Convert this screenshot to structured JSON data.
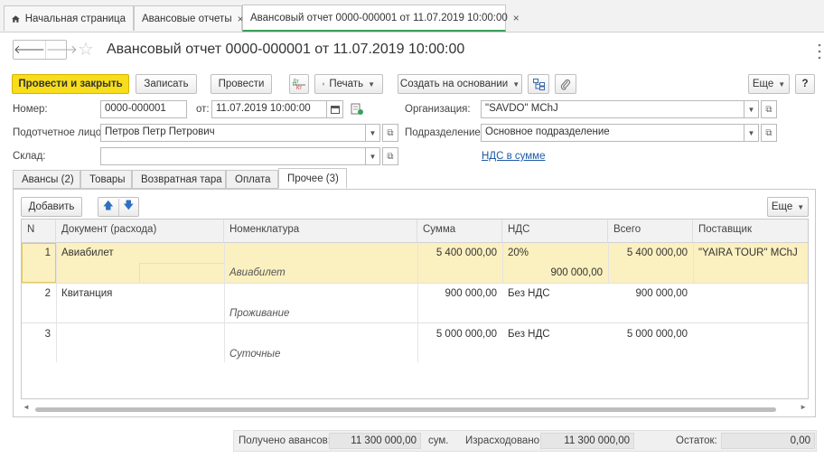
{
  "tabs": {
    "home": "Начальная страница",
    "list": "Авансовые отчеты",
    "doc": "Авансовый отчет 0000-000001 от 11.07.2019 10:00:00"
  },
  "title": "Авансовый отчет 0000-000001 от 11.07.2019 10:00:00",
  "toolbar": {
    "post_close": "Провести и закрыть",
    "save": "Записать",
    "post": "Провести",
    "dtkt": "Дт Кт",
    "print": "Печать",
    "create_based": "Создать на основании",
    "more": "Еще"
  },
  "fields": {
    "number_label": "Номер:",
    "number_value": "0000-000001",
    "date_label": "от:",
    "date_value": "11.07.2019 10:00:00",
    "org_label": "Организация:",
    "org_value": "\"SAVDO\" MChJ",
    "person_label": "Подотчетное лицо:",
    "person_value": "Петров Петр Петрович",
    "dept_label": "Подразделение:",
    "dept_value": "Основное подразделение",
    "warehouse_label": "Склад:",
    "warehouse_value": "",
    "vat_link": "НДС в сумме"
  },
  "inner_tabs": [
    "Авансы (2)",
    "Товары",
    "Возвратная тара",
    "Оплата",
    "Прочее (3)"
  ],
  "table_toolbar": {
    "add": "Добавить",
    "more": "Еще"
  },
  "columns": [
    "N",
    "Документ (расхода)",
    "Номенклатура",
    "Сумма",
    "НДС",
    "Всего",
    "Поставщик"
  ],
  "rows": [
    {
      "n": "1",
      "doc": "Авиабилет",
      "nomen": "Авиабилет",
      "sum": "5 400 000,00",
      "vat": "20%",
      "vat_sum": "900 000,00",
      "total": "5 400 000,00",
      "supplier": "\"YAIRA TOUR\" MChJ"
    },
    {
      "n": "2",
      "doc": "Квитанция",
      "nomen": "Проживание",
      "sum": "900 000,00",
      "vat": "Без НДС",
      "vat_sum": "",
      "total": "900 000,00",
      "supplier": ""
    },
    {
      "n": "3",
      "doc": "",
      "nomen": "Суточные",
      "sum": "5 000 000,00",
      "vat": "Без НДС",
      "vat_sum": "",
      "total": "5 000 000,00",
      "supplier": ""
    }
  ],
  "footer": {
    "received_label": "Получено авансов:",
    "received_value": "11 300 000,00",
    "currency": "сум.",
    "spent_label": "Израсходовано:",
    "spent_value": "11 300 000,00",
    "balance_label": "Остаток:",
    "balance_value": "0,00"
  },
  "colors": {
    "primary_button": "#f7dd1b",
    "row_highlight": "#fbf0bf",
    "active_tab_underline": "#3aa05a",
    "link": "#1d5aa6"
  }
}
